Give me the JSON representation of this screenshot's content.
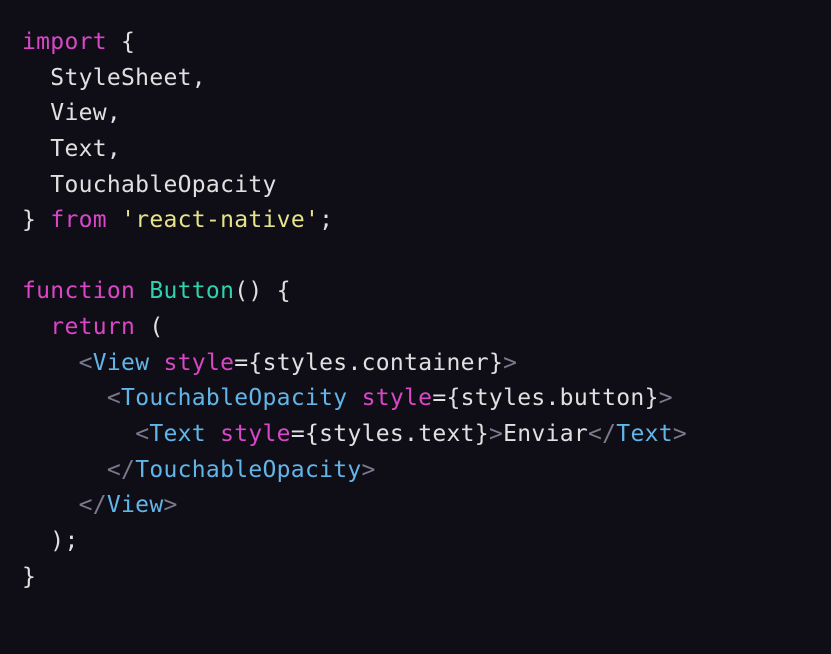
{
  "code": {
    "line1": {
      "import": "import",
      "brace_open": "{"
    },
    "line2": {
      "item": "StyleSheet",
      "comma": ","
    },
    "line3": {
      "item": "View",
      "comma": ","
    },
    "line4": {
      "item": "Text",
      "comma": ","
    },
    "line5": {
      "item": "TouchableOpacity"
    },
    "line6": {
      "brace_close": "}",
      "from": "from",
      "string": "'react-native'",
      "semi": ";"
    },
    "line8": {
      "function": "function",
      "name": "Button",
      "parens": "()",
      "brace": "{"
    },
    "line9": {
      "return": "return",
      "paren": "("
    },
    "line10": {
      "lt": "<",
      "tag": "View",
      "attr": "style",
      "eq": "=",
      "lbrace": "{",
      "expr1": "styles",
      "dot": ".",
      "expr2": "container",
      "rbrace": "}",
      "gt": ">"
    },
    "line11": {
      "lt": "<",
      "tag": "TouchableOpacity",
      "attr": "style",
      "eq": "=",
      "lbrace": "{",
      "expr1": "styles",
      "dot": ".",
      "expr2": "button",
      "rbrace": "}",
      "gt": ">"
    },
    "line12": {
      "lt": "<",
      "tag": "Text",
      "attr": "style",
      "eq": "=",
      "lbrace": "{",
      "expr1": "styles",
      "dot": ".",
      "expr2": "text",
      "rbrace": "}",
      "gt": ">",
      "content": "Enviar",
      "ltc": "</",
      "tagc": "Text",
      "gtc": ">"
    },
    "line13": {
      "ltc": "</",
      "tag": "TouchableOpacity",
      "gt": ">"
    },
    "line14": {
      "ltc": "</",
      "tag": "View",
      "gt": ">"
    },
    "line15": {
      "paren": ")",
      "semi": ";"
    },
    "line16": {
      "brace": "}"
    }
  }
}
